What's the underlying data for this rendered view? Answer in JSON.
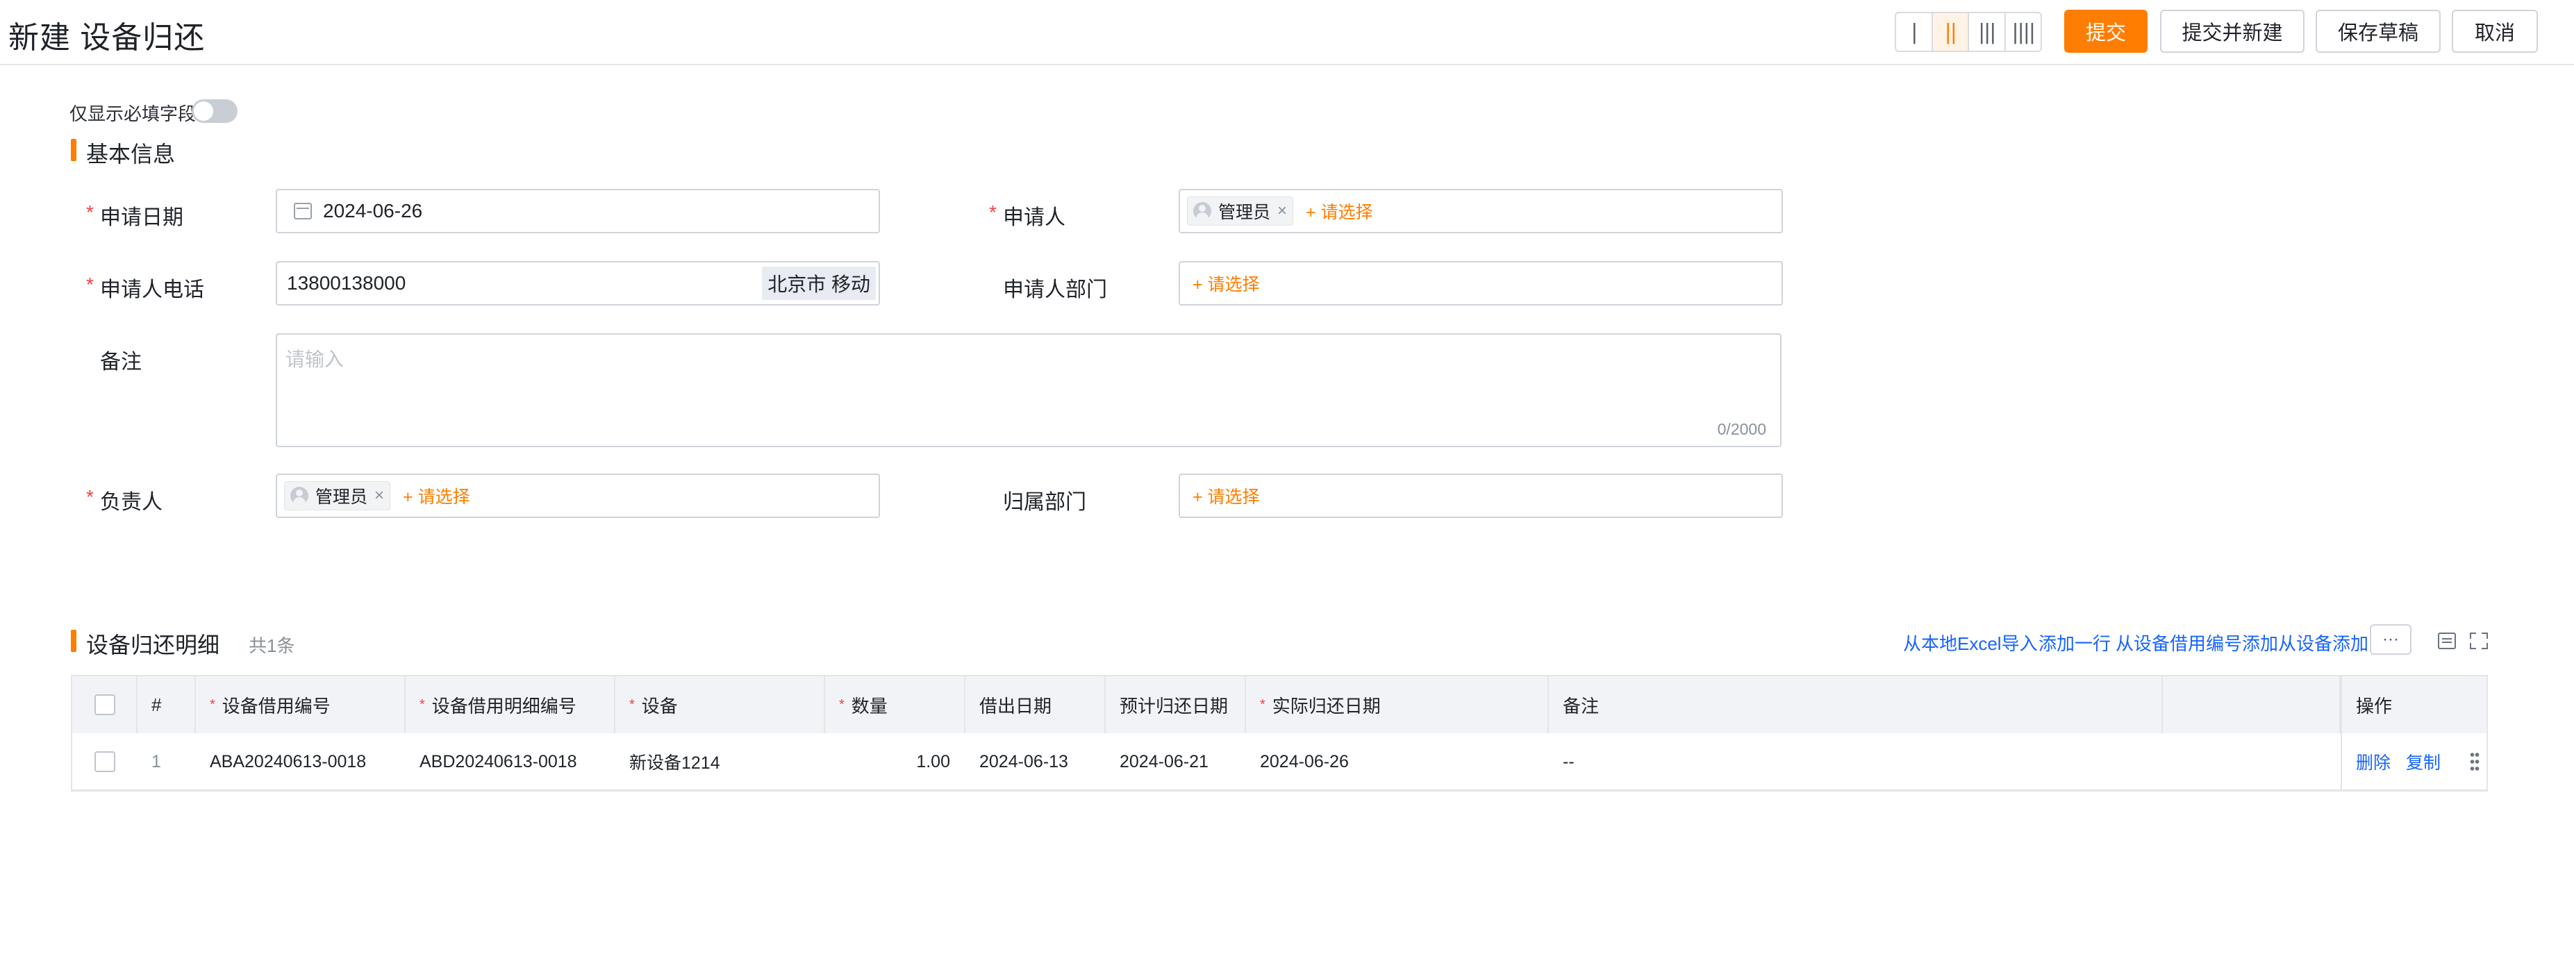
{
  "header": {
    "title": "新建 设备归还",
    "layout_options": [
      "|",
      "||",
      "|||",
      "||||"
    ],
    "active_layout_index": 1,
    "submit_label": "提交",
    "submit_new_label": "提交并新建",
    "save_draft_label": "保存草稿",
    "cancel_label": "取消"
  },
  "toggle": {
    "label": "仅显示必填字段",
    "on": false
  },
  "basic_section": {
    "title": "基本信息"
  },
  "form": {
    "apply_date": {
      "label": "申请日期",
      "value": "2024-06-26",
      "required": true
    },
    "applicant": {
      "label": "申请人",
      "tag": "管理员",
      "pick_label": "+ 请选择",
      "required": true
    },
    "phone": {
      "label": "申请人电话",
      "value": "13800138000",
      "carrier": "北京市 移动",
      "required": true
    },
    "dept": {
      "label": "申请人部门",
      "pick_label": "+ 请选择",
      "required": false
    },
    "remark": {
      "label": "备注",
      "placeholder": "请输入",
      "counter": "0/2000"
    },
    "owner": {
      "label": "负责人",
      "tag": "管理员",
      "pick_label": "+ 请选择",
      "required": true
    },
    "owner_dept": {
      "label": "归属部门",
      "pick_label": "+ 请选择",
      "required": false
    }
  },
  "detail_section": {
    "title": "设备归还明细",
    "count": "共1条",
    "actions": [
      "从本地Excel导入",
      "添加一行",
      "从设备借用编号添加",
      "从设备添加"
    ],
    "more_label": "···"
  },
  "table": {
    "columns": [
      {
        "label": "#",
        "required": false
      },
      {
        "label": "设备借用编号",
        "required": true
      },
      {
        "label": "设备借用明细编号",
        "required": true
      },
      {
        "label": "设备",
        "required": true
      },
      {
        "label": "数量",
        "required": true
      },
      {
        "label": "借出日期",
        "required": false
      },
      {
        "label": "预计归还日期",
        "required": false
      },
      {
        "label": "实际归还日期",
        "required": true
      },
      {
        "label": "备注",
        "required": false
      },
      {
        "label": "操作",
        "required": false
      }
    ],
    "rows": [
      {
        "index": "1",
        "borrow_no": "ABA20240613-0018",
        "detail_no": "ABD20240613-0018",
        "device": "新设备1214",
        "qty": "1.00",
        "lend_date": "2024-06-13",
        "expected_return": "2024-06-21",
        "actual_return": "2024-06-26",
        "remark": "--",
        "ops": [
          "删除",
          "复制"
        ]
      }
    ]
  },
  "colors": {
    "accent": "#ff7d00",
    "link": "#1664ff",
    "required": "#f53f3f"
  }
}
